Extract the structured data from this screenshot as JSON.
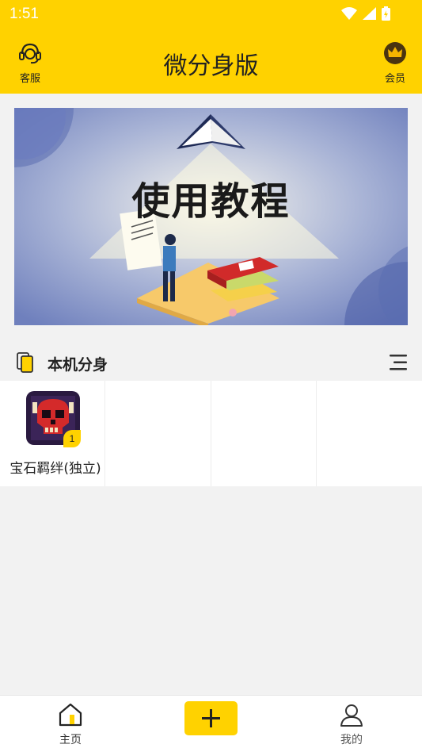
{
  "status_bar": {
    "time": "1:51"
  },
  "header": {
    "title": "微分身版",
    "left_button": {
      "label": "客服",
      "icon": "headset-icon"
    },
    "right_button": {
      "label": "会员",
      "icon": "crown-icon"
    }
  },
  "banner": {
    "title": "使用教程"
  },
  "section": {
    "title": "本机分身",
    "icon": "phone-icon",
    "menu_icon": "menu-icon"
  },
  "apps": [
    {
      "name": "宝石羁绊(独立)",
      "badge": "1",
      "icon": "skull-game-icon"
    }
  ],
  "bottom_nav": {
    "home": {
      "label": "主页",
      "icon": "home-icon"
    },
    "add": {
      "icon": "plus-icon"
    },
    "mine": {
      "label": "我的",
      "icon": "user-icon"
    }
  },
  "colors": {
    "accent": "#ffd200",
    "background": "#f2f2f2"
  }
}
